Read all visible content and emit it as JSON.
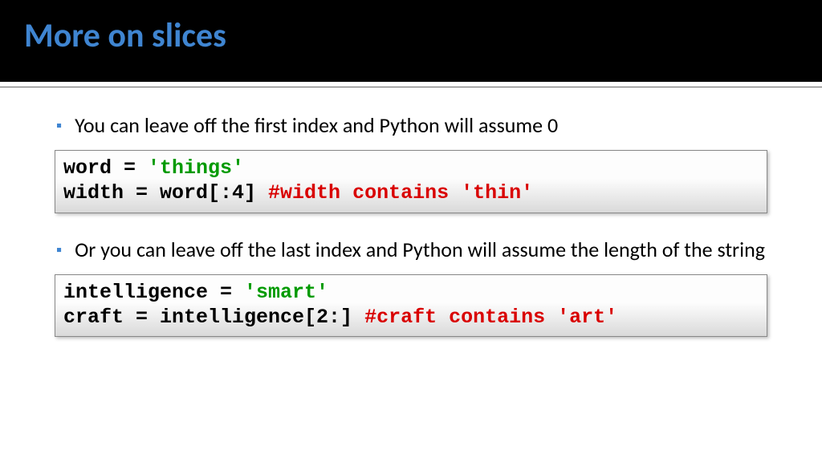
{
  "title": "More on slices",
  "bullets": [
    "You can leave off the first index and Python will assume 0",
    "Or you can leave off the last index and Python will assume the length of the string"
  ],
  "code1": {
    "l1a": "word = ",
    "l1b": "'things'",
    "l2a": "width = word[:4] ",
    "l2b": "#width contains 'thin'"
  },
  "code2": {
    "l1a": "intelligence = ",
    "l1b": "'smart'",
    "l2a": "craft = intelligence[2:] ",
    "l2b": "#craft contains 'art'"
  }
}
